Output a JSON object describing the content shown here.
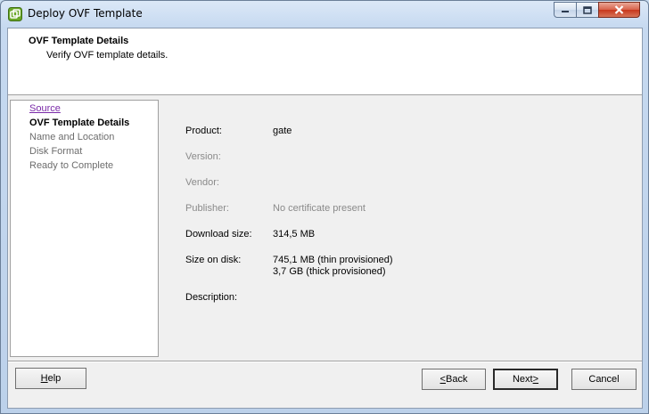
{
  "window": {
    "title": "Deploy OVF Template",
    "controls": {
      "minimize_icon": "minimize-icon",
      "maximize_icon": "maximize-icon",
      "close_icon": "close-icon"
    }
  },
  "header": {
    "title": "OVF Template Details",
    "subtitle": "Verify OVF template details."
  },
  "nav": {
    "items": [
      {
        "label": "Source",
        "state": "link"
      },
      {
        "label": "OVF Template Details",
        "state": "current"
      },
      {
        "label": "Name and Location",
        "state": "disabled"
      },
      {
        "label": "Disk Format",
        "state": "disabled"
      },
      {
        "label": "Ready to Complete",
        "state": "disabled"
      }
    ]
  },
  "details": {
    "product": {
      "label": "Product:",
      "value": "gate"
    },
    "version": {
      "label": "Version:",
      "value": ""
    },
    "vendor": {
      "label": "Vendor:",
      "value": ""
    },
    "publisher": {
      "label": "Publisher:",
      "value": "No certificate present"
    },
    "download_size": {
      "label": "Download size:",
      "value": "314,5 MB"
    },
    "size_on_disk": {
      "label": "Size on disk:",
      "value_thin": "745,1 MB (thin provisioned)",
      "value_thick": "3,7 GB (thick provisioned)"
    },
    "description": {
      "label": "Description:",
      "value": ""
    }
  },
  "buttons": {
    "help": {
      "pre": "",
      "key": "H",
      "post": "elp"
    },
    "back": {
      "pre": "",
      "key": "<",
      "post": " Back"
    },
    "next": {
      "pre": "Next ",
      "key": ">",
      "post": ""
    },
    "cancel": {
      "label": "Cancel"
    }
  },
  "colors": {
    "link": "#7a2aa8",
    "disabled_text": "#6d6d6d",
    "muted_text": "#8a8a8a"
  }
}
